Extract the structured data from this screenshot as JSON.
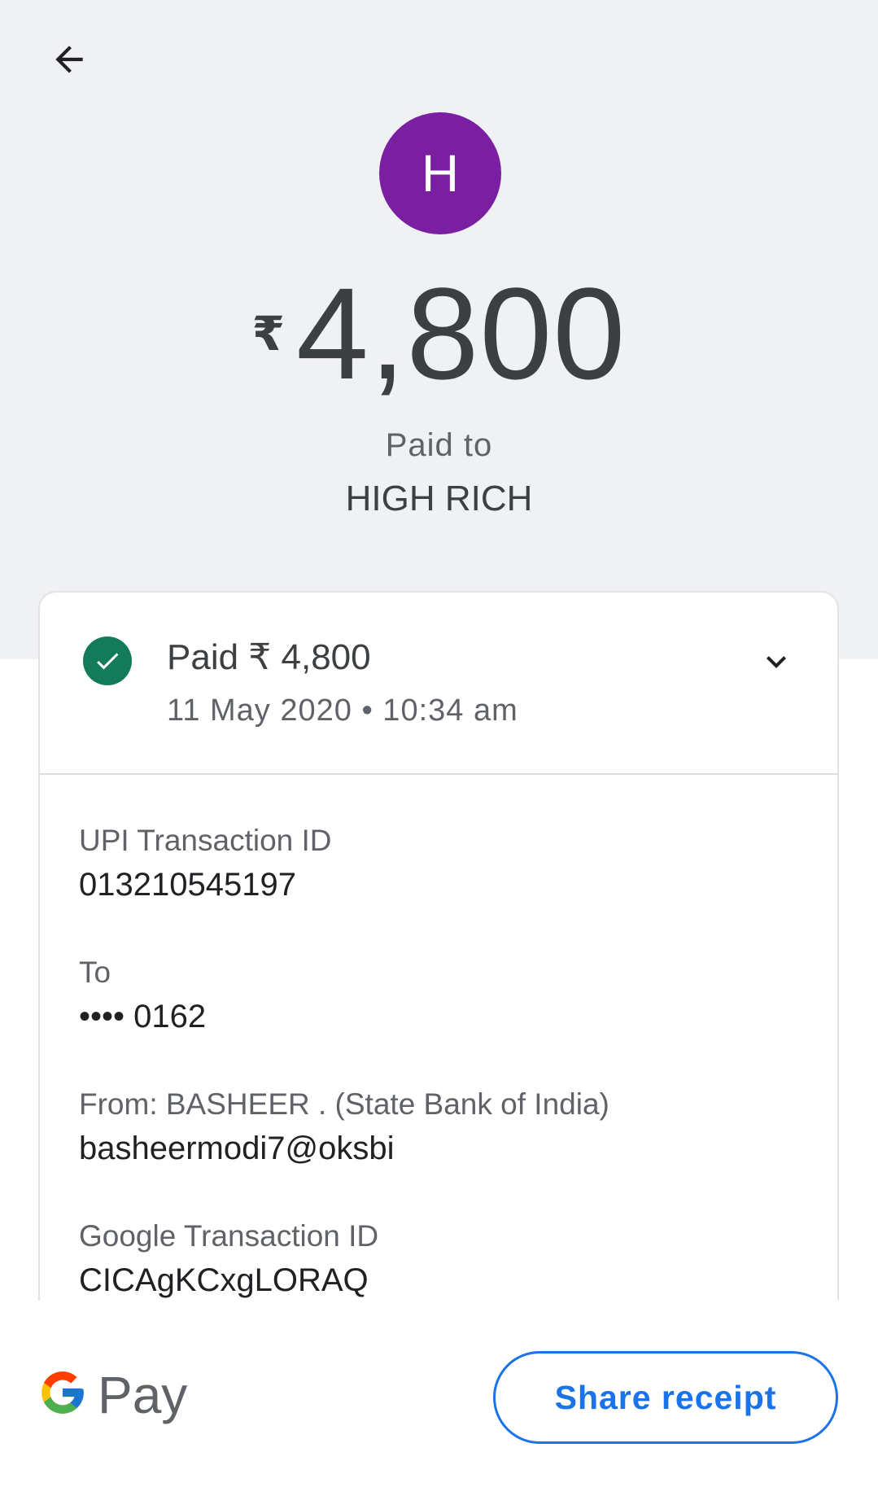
{
  "header": {
    "back_icon": "arrow-left-icon",
    "avatar_initial": "H",
    "avatar_color": "#7b1fa2",
    "currency_symbol": "₹",
    "amount": "4,800",
    "paid_to_label": "Paid to",
    "payee_name": "HIGH RICH"
  },
  "summary": {
    "status_icon": "check-circle-icon",
    "status_color": "#137b5a",
    "title": "Paid ₹ 4,800",
    "datetime": "11 May 2020 • 10:34 am",
    "expand_icon": "chevron-down-icon"
  },
  "details": [
    {
      "label": "UPI Transaction ID",
      "value": "013210545197"
    },
    {
      "label": "To",
      "value": "•••• 0162"
    },
    {
      "label": "From: BASHEER  . (State Bank of India)",
      "value": "basheermodi7@oksbi"
    },
    {
      "label": "Google Transaction ID",
      "value": "CICAgKCxgLORAQ"
    }
  ],
  "footer": {
    "brand_text": "Pay",
    "brand_icon": "google-g-icon",
    "share_label": "Share receipt",
    "accent_color": "#1a73e8"
  }
}
